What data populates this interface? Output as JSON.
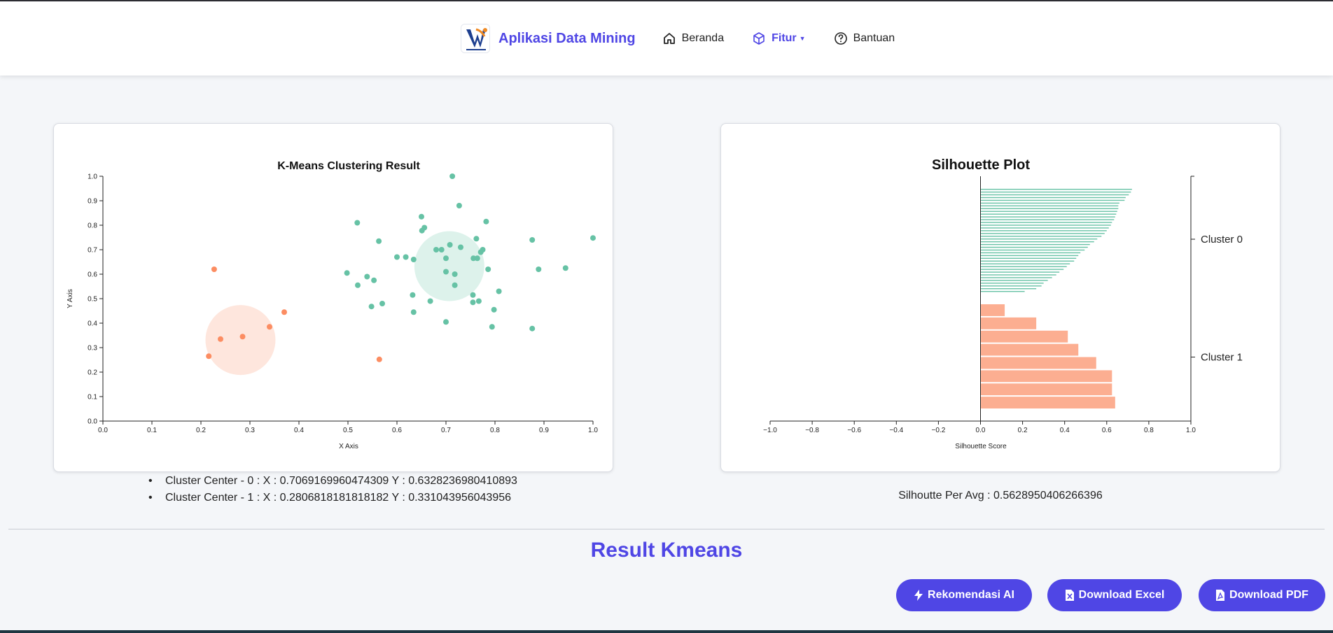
{
  "nav": {
    "brand": "Aplikasi Data Mining",
    "items": [
      {
        "label": "Beranda",
        "icon": "home-icon"
      },
      {
        "label": "Fitur",
        "icon": "cube-icon",
        "active": true,
        "dropdown": true
      },
      {
        "label": "Bantuan",
        "icon": "help-circle-icon"
      }
    ]
  },
  "colors": {
    "accent": "#4f46e5",
    "cluster0": "#66c2a5",
    "cluster1": "#fc8d62",
    "cluster1_bar": "#fcae91"
  },
  "kmeans_chart": {
    "chart_data": {
      "type": "scatter",
      "title": "K-Means Clustering Result",
      "xlabel": "X Axis",
      "ylabel": "Y Axis",
      "xlim": [
        0.0,
        1.0
      ],
      "ylim": [
        0.0,
        1.0
      ],
      "x_ticks": [
        "0.0",
        "0.1",
        "0.2",
        "0.3",
        "0.4",
        "0.5",
        "0.6",
        "0.7",
        "0.8",
        "0.9",
        "1.0"
      ],
      "y_ticks": [
        "0.0",
        "0.1",
        "0.2",
        "0.3",
        "0.4",
        "0.5",
        "0.6",
        "0.7",
        "0.8",
        "0.9",
        "1.0"
      ],
      "series": [
        {
          "cluster": 0,
          "points": [
            [
              0.713,
              1.0
            ],
            [
              0.727,
              0.88
            ],
            [
              0.519,
              0.81
            ],
            [
              0.65,
              0.835
            ],
            [
              0.656,
              0.79
            ],
            [
              0.651,
              0.778
            ],
            [
              0.782,
              0.815
            ],
            [
              0.876,
              0.74
            ],
            [
              1.0,
              0.748
            ],
            [
              0.563,
              0.735
            ],
            [
              0.762,
              0.745
            ],
            [
              0.775,
              0.7
            ],
            [
              0.771,
              0.69
            ],
            [
              0.691,
              0.7
            ],
            [
              0.68,
              0.7
            ],
            [
              0.708,
              0.72
            ],
            [
              0.73,
              0.71
            ],
            [
              0.6,
              0.67
            ],
            [
              0.618,
              0.67
            ],
            [
              0.7,
              0.665
            ],
            [
              0.634,
              0.66
            ],
            [
              0.756,
              0.665
            ],
            [
              0.764,
              0.665
            ],
            [
              0.498,
              0.605
            ],
            [
              0.539,
              0.59
            ],
            [
              0.553,
              0.575
            ],
            [
              0.52,
              0.555
            ],
            [
              0.7,
              0.61
            ],
            [
              0.718,
              0.6
            ],
            [
              0.786,
              0.62
            ],
            [
              0.889,
              0.62
            ],
            [
              0.944,
              0.625
            ],
            [
              0.718,
              0.555
            ],
            [
              0.808,
              0.53
            ],
            [
              0.632,
              0.515
            ],
            [
              0.755,
              0.515
            ],
            [
              0.57,
              0.48
            ],
            [
              0.548,
              0.468
            ],
            [
              0.668,
              0.49
            ],
            [
              0.755,
              0.485
            ],
            [
              0.767,
              0.49
            ],
            [
              0.798,
              0.455
            ],
            [
              0.634,
              0.445
            ],
            [
              0.7,
              0.405
            ],
            [
              0.794,
              0.385
            ],
            [
              0.876,
              0.378
            ]
          ],
          "center": [
            0.7069169960474309,
            0.6328236980410893
          ]
        },
        {
          "cluster": 1,
          "points": [
            [
              0.227,
              0.62
            ],
            [
              0.37,
              0.445
            ],
            [
              0.34,
              0.385
            ],
            [
              0.285,
              0.345
            ],
            [
              0.24,
              0.335
            ],
            [
              0.216,
              0.265
            ],
            [
              0.564,
              0.252
            ]
          ],
          "center": [
            0.2806818181818182,
            0.331043956043956
          ]
        }
      ]
    }
  },
  "silhouette_chart": {
    "chart_data": {
      "type": "bar",
      "orientation": "horizontal",
      "title": "Silhouette Plot",
      "xlabel": "Silhouette Score",
      "xlim": [
        -1.0,
        1.0
      ],
      "x_ticks": [
        "−1.0",
        "−0.8",
        "−0.6",
        "−0.4",
        "−0.2",
        "0.0",
        "0.2",
        "0.4",
        "0.6",
        "0.8",
        "1.0"
      ],
      "clusters": [
        {
          "name": "Cluster 0",
          "values": [
            0.72,
            0.715,
            0.705,
            0.69,
            0.685,
            0.66,
            0.655,
            0.655,
            0.65,
            0.645,
            0.64,
            0.635,
            0.625,
            0.62,
            0.61,
            0.6,
            0.59,
            0.575,
            0.555,
            0.54,
            0.52,
            0.51,
            0.495,
            0.475,
            0.465,
            0.455,
            0.445,
            0.425,
            0.41,
            0.395,
            0.375,
            0.36,
            0.34,
            0.32,
            0.3,
            0.29,
            0.265,
            0.21
          ]
        },
        {
          "name": "Cluster 1",
          "values": [
            0.64,
            0.625,
            0.625,
            0.55,
            0.465,
            0.415,
            0.265,
            0.115
          ]
        }
      ]
    }
  },
  "centers": [
    "Cluster Center - 0 : X : 0.7069169960474309 Y : 0.6328236980410893",
    "Cluster Center - 1 : X : 0.2806818181818182 Y : 0.331043956043956"
  ],
  "silhouette_avg": "Silhoutte Per Avg : 0.5628950406266396",
  "result_title": "Result Kmeans",
  "buttons": {
    "recommend": "Rekomendasi AI",
    "excel": "Download Excel",
    "pdf": "Download PDF"
  }
}
